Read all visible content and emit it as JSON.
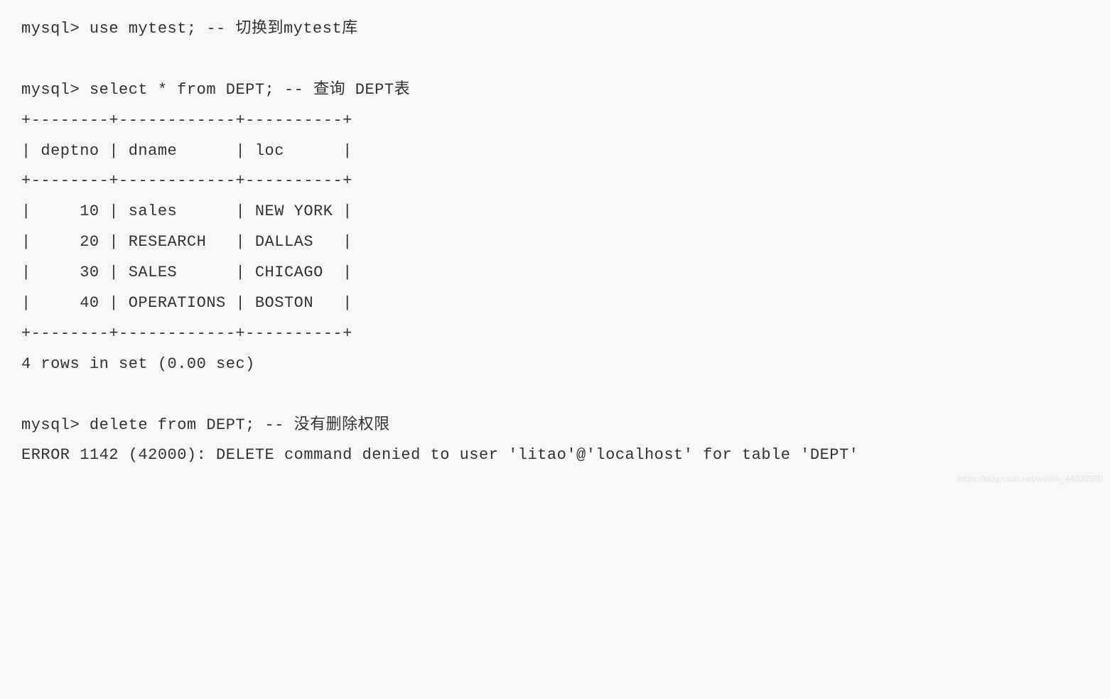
{
  "lines": [
    "mysql> use mytest; -- 切换到mytest库",
    "",
    "mysql> select * from DEPT; -- 查询 DEPT表",
    "+--------+------------+----------+",
    "| deptno | dname      | loc      |",
    "+--------+------------+----------+",
    "|     10 | sales      | NEW YORK |",
    "|     20 | RESEARCH   | DALLAS   |",
    "|     30 | SALES      | CHICAGO  |",
    "|     40 | OPERATIONS | BOSTON   |",
    "+--------+------------+----------+",
    "4 rows in set (0.00 sec)",
    "",
    "mysql> delete from DEPT; -- 没有删除权限",
    "ERROR 1142 (42000): DELETE command denied to user 'litao'@'localhost' for table 'DEPT'"
  ],
  "watermark": "https://blog.csdn.net/weixin_44030580",
  "table_data": {
    "columns": [
      "deptno",
      "dname",
      "loc"
    ],
    "rows": [
      {
        "deptno": 10,
        "dname": "sales",
        "loc": "NEW YORK"
      },
      {
        "deptno": 20,
        "dname": "RESEARCH",
        "loc": "DALLAS"
      },
      {
        "deptno": 30,
        "dname": "SALES",
        "loc": "CHICAGO"
      },
      {
        "deptno": 40,
        "dname": "OPERATIONS",
        "loc": "BOSTON"
      }
    ],
    "row_count": 4,
    "query_time": "0.00 sec"
  },
  "commands": [
    {
      "prompt": "mysql>",
      "sql": "use mytest;",
      "comment": "切换到mytest库"
    },
    {
      "prompt": "mysql>",
      "sql": "select * from DEPT;",
      "comment": "查询 DEPT表"
    },
    {
      "prompt": "mysql>",
      "sql": "delete from DEPT;",
      "comment": "没有删除权限"
    }
  ],
  "error": {
    "code": 1142,
    "sqlstate": "42000",
    "message": "DELETE command denied to user 'litao'@'localhost' for table 'DEPT'"
  }
}
